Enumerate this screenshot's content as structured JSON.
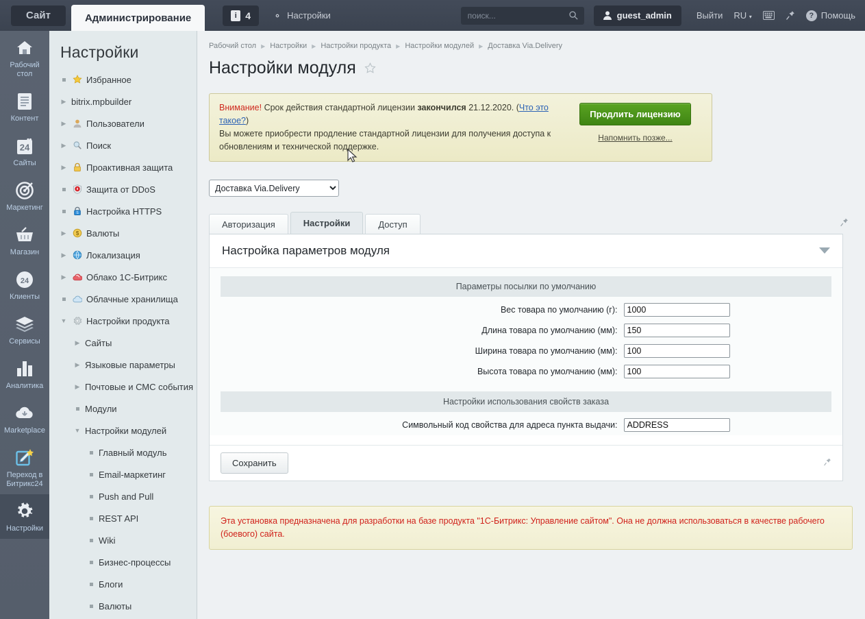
{
  "topbar": {
    "site_tab": "Сайт",
    "admin_tab": "Администрирование",
    "notif_count": "4",
    "notif_icon": "info-icon",
    "settings_link": "Настройки",
    "settings_icon": "gear-icon",
    "search_placeholder": "поиск...",
    "search_value": "",
    "search_icon": "search-icon",
    "user": "guest_admin",
    "user_icon": "user-icon",
    "logout": "Выйти",
    "lang": "RU",
    "keyboard_icon": "keyboard-icon",
    "pin_icon": "pin-icon",
    "help": "Помощь",
    "help_icon": "question-icon"
  },
  "rail": [
    {
      "label": "Рабочий стол",
      "icon": "home-icon",
      "active": false
    },
    {
      "label": "Контент",
      "icon": "document-icon",
      "active": false
    },
    {
      "label": "Сайты",
      "icon": "calendar24-icon",
      "active": false
    },
    {
      "label": "Маркетинг",
      "icon": "target-icon",
      "active": false
    },
    {
      "label": "Магазин",
      "icon": "basket-icon",
      "active": false
    },
    {
      "label": "Клиенты",
      "icon": "circle24-icon",
      "active": false
    },
    {
      "label": "Сервисы",
      "icon": "layers-icon",
      "active": false
    },
    {
      "label": "Аналитика",
      "icon": "bar-chart-icon",
      "active": false
    },
    {
      "label": "Marketplace",
      "icon": "cloud-download-icon",
      "active": false
    },
    {
      "label": "Переход в Битрикс24",
      "icon": "edit-star-icon",
      "active": false
    },
    {
      "label": "Настройки",
      "icon": "gear-icon",
      "active": true
    }
  ],
  "sidebar": {
    "title": "Настройки",
    "items": [
      {
        "label": "Избранное",
        "level": 1,
        "marker": "dot",
        "icon": "star-icon"
      },
      {
        "label": "bitrix.mpbuilder",
        "level": 1,
        "marker": "arrow",
        "icon": "none"
      },
      {
        "label": "Пользователи",
        "level": 1,
        "marker": "arrow",
        "icon": "user-icon"
      },
      {
        "label": "Поиск",
        "level": 1,
        "marker": "arrow",
        "icon": "magnifier-icon"
      },
      {
        "label": "Проактивная защита",
        "level": 1,
        "marker": "arrow",
        "icon": "lock-icon"
      },
      {
        "label": "Защита от DDoS",
        "level": 1,
        "marker": "dot",
        "icon": "shield-icon"
      },
      {
        "label": "Настройка HTTPS",
        "level": 1,
        "marker": "dot",
        "icon": "bluelock-icon"
      },
      {
        "label": "Валюты",
        "level": 1,
        "marker": "arrow",
        "icon": "coin-icon"
      },
      {
        "label": "Локализация",
        "level": 1,
        "marker": "arrow",
        "icon": "globe-icon"
      },
      {
        "label": "Облако 1С-Битрикс",
        "level": 1,
        "marker": "arrow",
        "icon": "redcloud-icon"
      },
      {
        "label": "Облачные хранилища",
        "level": 1,
        "marker": "dot",
        "icon": "bluecloud-icon"
      },
      {
        "label": "Настройки продукта",
        "level": 1,
        "marker": "arrow-down",
        "icon": "gear-icon"
      },
      {
        "label": "Сайты",
        "level": 2,
        "marker": "arrow",
        "icon": "none"
      },
      {
        "label": "Языковые параметры",
        "level": 2,
        "marker": "arrow",
        "icon": "none"
      },
      {
        "label": "Почтовые и СМС события",
        "level": 2,
        "marker": "arrow",
        "icon": "none"
      },
      {
        "label": "Модули",
        "level": 2,
        "marker": "dot",
        "icon": "none"
      },
      {
        "label": "Настройки модулей",
        "level": 2,
        "marker": "arrow-down",
        "icon": "none"
      },
      {
        "label": "Главный модуль",
        "level": 3,
        "marker": "dot",
        "icon": "none"
      },
      {
        "label": "Email-маркетинг",
        "level": 3,
        "marker": "dot",
        "icon": "none"
      },
      {
        "label": "Push and Pull",
        "level": 3,
        "marker": "dot",
        "icon": "none"
      },
      {
        "label": "REST API",
        "level": 3,
        "marker": "dot",
        "icon": "none"
      },
      {
        "label": "Wiki",
        "level": 3,
        "marker": "dot",
        "icon": "none"
      },
      {
        "label": "Бизнес-процессы",
        "level": 3,
        "marker": "dot",
        "icon": "none"
      },
      {
        "label": "Блоги",
        "level": 3,
        "marker": "dot",
        "icon": "none"
      },
      {
        "label": "Валюты",
        "level": 3,
        "marker": "dot",
        "icon": "none"
      }
    ]
  },
  "breadcrumb": [
    "Рабочий стол",
    "Настройки",
    "Настройки продукта",
    "Настройки модулей",
    "Доставка Via.Delivery"
  ],
  "page": {
    "title": "Настройки модуля",
    "favorite_icon": "star-outline-icon"
  },
  "license_banner": {
    "attention": "Внимание!",
    "line1_a": " Срок действия стандартной лицензии ",
    "line1_bold": "закончился",
    "line1_b": " 21.12.2020. (",
    "link_what": "Что это такое?",
    "line1_c": ")",
    "line2": "Вы можете приобрести продление стандартной лицензии для получения доступа к обновлениям и технической поддержке.",
    "renew_button": "Продлить лицензию",
    "remind_later": "Напомнить позже...",
    "button_color": "#4c9219"
  },
  "module_select": {
    "selected": "Доставка Via.Delivery",
    "options": [
      "Доставка Via.Delivery"
    ]
  },
  "tabs": [
    {
      "label": "Авторизация",
      "active": false
    },
    {
      "label": "Настройки",
      "active": true
    },
    {
      "label": "Доступ",
      "active": false
    }
  ],
  "tab_pin_icon": "pin-icon",
  "panel": {
    "title": "Настройка параметров модуля",
    "collapse_icon": "chevron-down-icon",
    "sections": [
      {
        "heading": "Параметры посылки по умолчанию",
        "fields": [
          {
            "label": "Вес товара по умолчанию (г):",
            "value": "1000",
            "name": "default-weight-field"
          },
          {
            "label": "Длина товара по умолчанию (мм):",
            "value": "150",
            "name": "default-length-field"
          },
          {
            "label": "Ширина товара по умолчанию (мм):",
            "value": "100",
            "name": "default-width-field"
          },
          {
            "label": "Высота товара по умолчанию (мм):",
            "value": "100",
            "name": "default-height-field"
          }
        ]
      },
      {
        "heading": "Настройки использования свойств заказа",
        "fields": [
          {
            "label": "Символьный код свойства для адреса пункта выдачи:",
            "value": "ADDRESS",
            "name": "pickup-address-code-field"
          }
        ]
      }
    ],
    "save_button": "Сохранить",
    "foot_pin_icon": "pin-icon"
  },
  "dev_notice": "Эта установка предназначена для разработки на базе продукта \"1С-Битрикс: Управление сайтом\". Она не должна использоваться в качестве рабочего (боевого) сайта."
}
